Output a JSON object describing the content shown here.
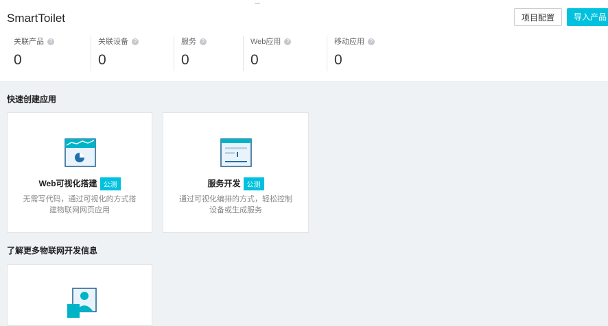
{
  "header": {
    "title": "SmartToilet",
    "config_button": "项目配置",
    "import_button": "导入产品"
  },
  "stats": [
    {
      "label": "关联产品",
      "value": "0"
    },
    {
      "label": "关联设备",
      "value": "0"
    },
    {
      "label": "服务",
      "value": "0"
    },
    {
      "label": "Web应用",
      "value": "0"
    },
    {
      "label": "移动应用",
      "value": "0"
    }
  ],
  "help_icon_glyph": "?",
  "quick_create": {
    "title": "快速创建应用",
    "cards": [
      {
        "name": "Web可视化搭建",
        "badge": "公测",
        "desc": "无需写代码，通过可视化的方式搭建物联网网页应用",
        "icon": "web-visual-icon"
      },
      {
        "name": "服务开发",
        "badge": "公测",
        "desc": "通过可视化编排的方式，轻松控制设备或生成服务",
        "icon": "service-dev-icon"
      }
    ]
  },
  "learn_more": {
    "title": "了解更多物联网开发信息",
    "icon": "developer-profile-icon"
  },
  "colors": {
    "accent": "#00c1de",
    "background": "#eef2f5"
  }
}
